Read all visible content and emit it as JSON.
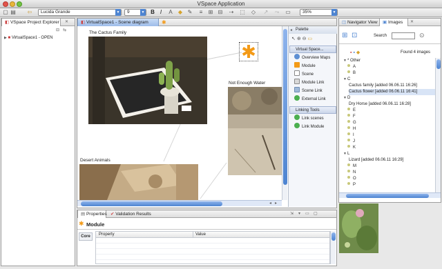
{
  "window": {
    "title": "VSpace Application"
  },
  "toolbar": {
    "font_family": "Lucida Grande",
    "font_size": "9",
    "zoom": "35%",
    "bold": "B",
    "italic": "I"
  },
  "explorer": {
    "tab": "VSpace Project Explorer",
    "root_item": "VirtualSpace1 - OPEN"
  },
  "editor": {
    "tab": "VirtualSpace1 - Scene diagram",
    "scenes": [
      {
        "label": "The Cactus Family"
      },
      {
        "label": "Not Enough Water"
      },
      {
        "label": "Desert Animals"
      }
    ]
  },
  "palette": {
    "title": "Palette",
    "sections": [
      {
        "title": "Virtual Space...",
        "items": [
          "Overview Maps",
          "Module",
          "Scene",
          "Module Link",
          "Scene Link",
          "External Link"
        ]
      },
      {
        "title": "Linking Tools",
        "items": [
          "Link scenes",
          "Link Module"
        ]
      }
    ]
  },
  "right_panel": {
    "tabs": [
      "Navigator View",
      "Images"
    ],
    "search_label": "Search",
    "found_text": "Found 4 images",
    "tree": [
      {
        "text": "* Other",
        "kind": "group-open"
      },
      {
        "text": "A",
        "kind": "dot"
      },
      {
        "text": "B",
        "kind": "dot"
      },
      {
        "text": "C",
        "kind": "group-open"
      },
      {
        "text": "Cactus family [added 06.06.11 16:26]",
        "kind": "child"
      },
      {
        "text": "Cactus flower [added 06.06.11 16:41]",
        "kind": "child-selected"
      },
      {
        "text": "D",
        "kind": "group-open"
      },
      {
        "text": "Dry Horse [added 06.06.11 16:28]",
        "kind": "child"
      },
      {
        "text": "E",
        "kind": "dot"
      },
      {
        "text": "F",
        "kind": "dot"
      },
      {
        "text": "G",
        "kind": "dot"
      },
      {
        "text": "H",
        "kind": "dot"
      },
      {
        "text": "I",
        "kind": "dot"
      },
      {
        "text": "J",
        "kind": "dot"
      },
      {
        "text": "K",
        "kind": "dot"
      },
      {
        "text": "L",
        "kind": "group-open"
      },
      {
        "text": "Lizard [added 06.06.11 16:29]",
        "kind": "child"
      },
      {
        "text": "M",
        "kind": "dot"
      },
      {
        "text": "N",
        "kind": "dot"
      },
      {
        "text": "O",
        "kind": "dot"
      },
      {
        "text": "P",
        "kind": "dot"
      }
    ]
  },
  "bottom": {
    "tabs": [
      "Properties",
      "Validation Results"
    ],
    "module_title": "Module",
    "side_tab": "Core",
    "columns": [
      "Property",
      "Value"
    ]
  },
  "colors": {
    "accent_blue": "#4d84d1",
    "selection": "#d8e4f6",
    "module_orange": "#f39a17"
  }
}
